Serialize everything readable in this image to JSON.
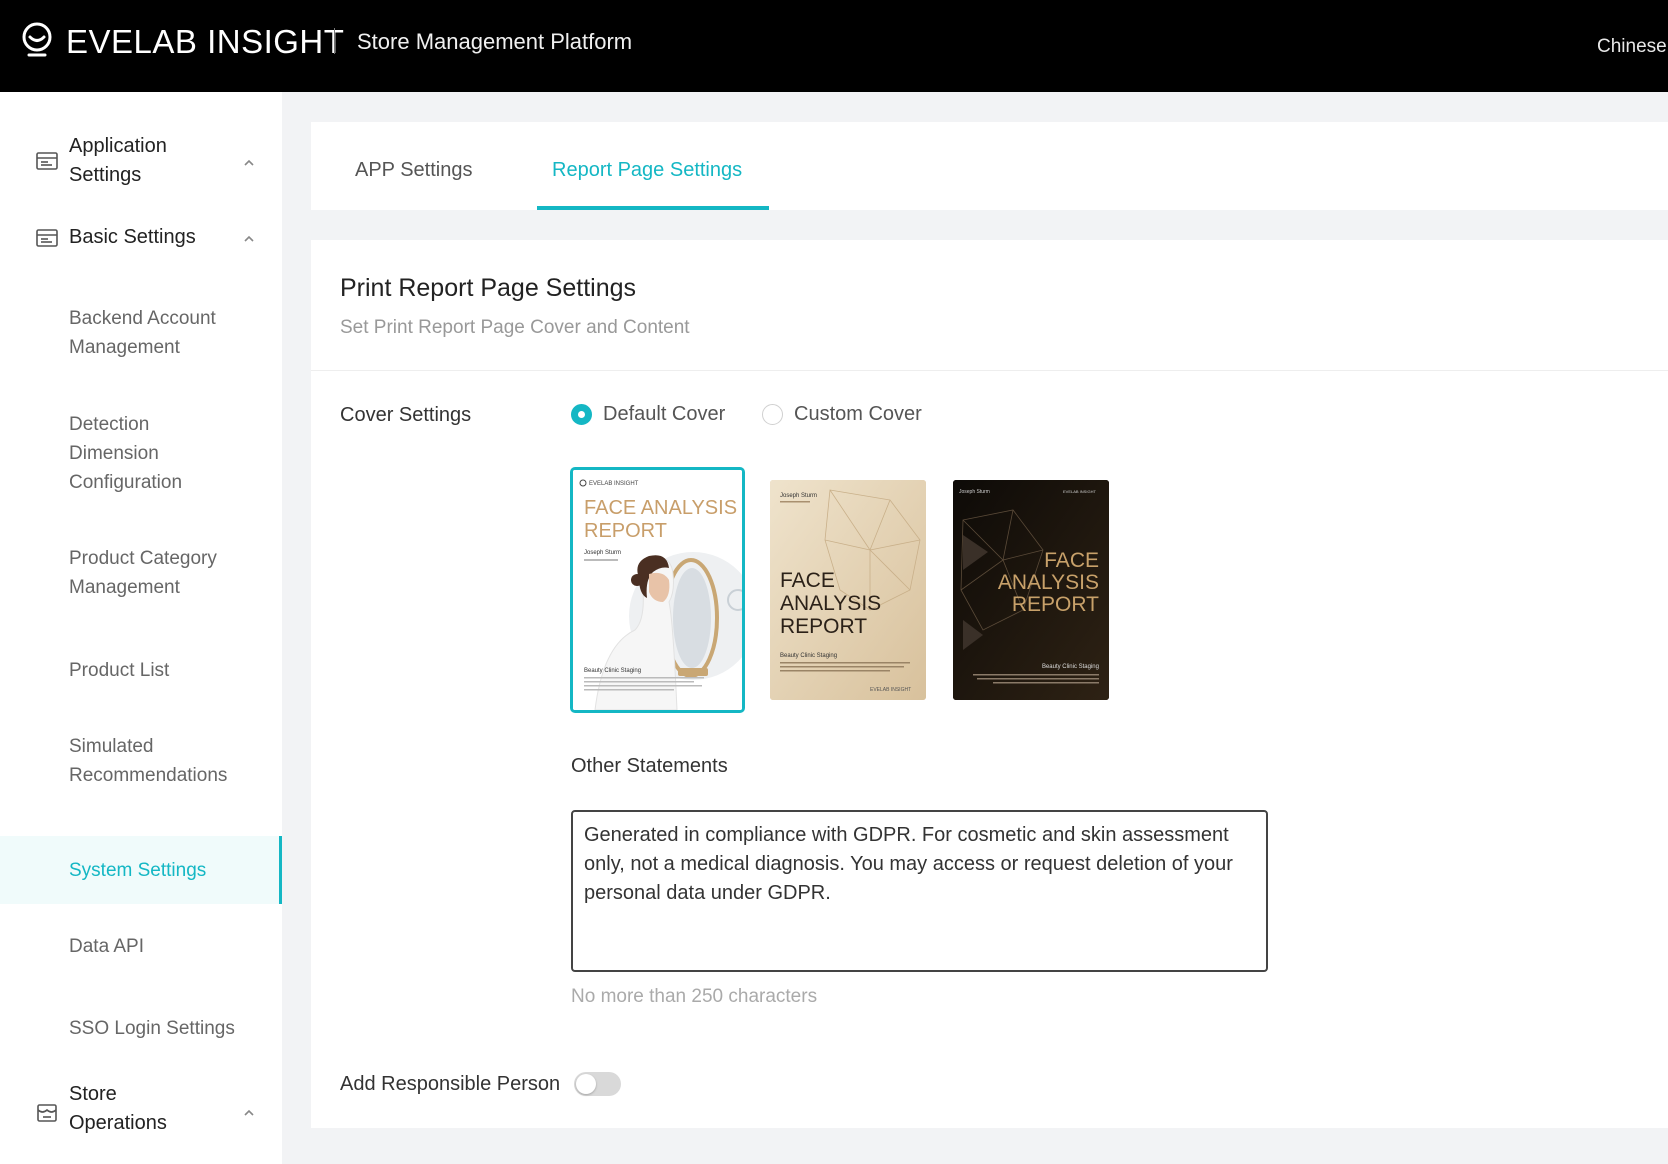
{
  "header": {
    "brand": "EVELAB INSIGHT",
    "platform": "Store Management Platform",
    "language": "Chinese",
    "logo_icon": "face-smile-logo-icon"
  },
  "sidebar": {
    "groups": [
      {
        "label": "Application Settings",
        "icon": "settings-panel-icon",
        "expanded": true
      },
      {
        "label": "Basic Settings",
        "icon": "settings-panel-icon",
        "expanded": true
      },
      {
        "label": "Store Operations",
        "icon": "store-icon",
        "expanded": true
      }
    ],
    "items": [
      {
        "label": "Backend Account Management"
      },
      {
        "label": "Detection Dimension Configuration"
      },
      {
        "label": "Product Category Management"
      },
      {
        "label": "Product List"
      },
      {
        "label": "Simulated Recommendations"
      },
      {
        "label": "System Settings",
        "active": true
      },
      {
        "label": "Data API"
      },
      {
        "label": "SSO Login Settings"
      }
    ]
  },
  "tabs": [
    {
      "label": "APP Settings",
      "active": false
    },
    {
      "label": "Report Page Settings",
      "active": true
    }
  ],
  "report": {
    "title": "Print Report Page Settings",
    "subtitle": "Set Print Report Page Cover and Content",
    "cover_label": "Cover Settings",
    "cover_options": [
      {
        "label": "Default Cover",
        "checked": true
      },
      {
        "label": "Custom Cover",
        "checked": false
      }
    ],
    "covers": [
      {
        "title_line1": "FACE ANALYSIS",
        "title_line2": "REPORT",
        "brand": "EVELAB INSIGHT",
        "name": "Joseph Sturm",
        "footer": "Beauty Clinic Staging",
        "selected": true
      },
      {
        "title_line1": "FACE",
        "title_line2": "ANALYSIS",
        "title_line3": "REPORT",
        "name": "Joseph Sturm",
        "footer": "Beauty Clinic Staging",
        "brand": "EVELAB INSIGHT",
        "selected": false
      },
      {
        "title_line1": "FACE",
        "title_line2": "ANALYSIS",
        "title_line3": "REPORT",
        "name": "Joseph Sturm",
        "footer": "Beauty Clinic Staging",
        "brand": "EVELAB INSIGHT",
        "selected": false
      }
    ],
    "statements_label": "Other Statements",
    "statements_value": "Generated in compliance with GDPR. For cosmetic and skin assessment only, not a medical diagnosis. You may access or request deletion of your personal data under GDPR.",
    "statements_hint": "No more than 250 characters",
    "responsible_label": "Add Responsible Person",
    "responsible_enabled": false
  },
  "colors": {
    "accent": "#14b7c4",
    "topbar": "#000000",
    "cover_beige": "#e3d2b4",
    "cover_dark": "#1c140c",
    "cover_gold": "#c8a16a"
  }
}
